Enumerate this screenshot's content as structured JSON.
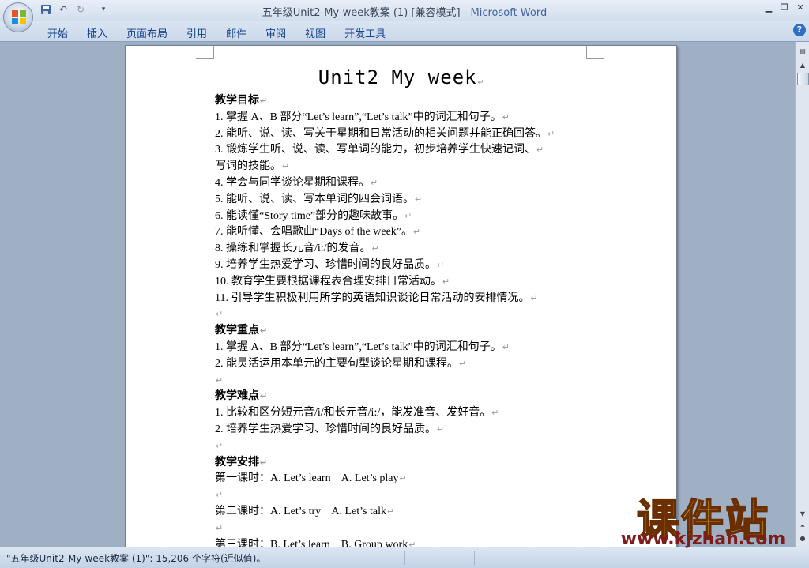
{
  "window": {
    "title": "五年级Unit2-My-week教案 (1) [兼容模式] - ",
    "app_name": "Microsoft Word"
  },
  "quick_access": {
    "save_icon": "save-icon",
    "undo_icon": "undo-icon",
    "redo_icon": "redo-icon",
    "customize_icon": "customize-icon"
  },
  "ribbon": {
    "tabs": [
      "开始",
      "插入",
      "页面布局",
      "引用",
      "邮件",
      "审阅",
      "视图",
      "开发工具"
    ],
    "help": "?"
  },
  "document": {
    "title": "Unit2 My week",
    "sections": [
      {
        "heading": "教学目标",
        "items": [
          "1. 掌握 A、B 部分“Let’s learn”,“Let’s talk”中的词汇和句子。",
          "2. 能听、说、读、写关于星期和日常活动的相关问题并能正确回答。",
          "3. 锻炼学生听、说、读、写单词的能力，初步培养学生快速记词、",
          "写词的技能。",
          "4. 学会与同学谈论星期和课程。",
          "5. 能听、说、读、写本单词的四会词语。",
          "6. 能读懂“Story time”部分的趣味故事。",
          "7. 能听懂、会唱歌曲“Days of the week”。",
          "8. 操练和掌握长元音/i:/的发音。",
          "9. 培养学生热爱学习、珍惜时间的良好品质。",
          "10. 教育学生要根据课程表合理安排日常活动。",
          "11. 引导学生积极利用所学的英语知识谈论日常活动的安排情况。"
        ]
      },
      {
        "heading": "教学重点",
        "items": [
          "1. 掌握 A、B 部分“Let’s learn”,“Let’s talk”中的词汇和句子。",
          "2. 能灵活运用本单元的主要句型谈论星期和课程。"
        ]
      },
      {
        "heading": "教学难点",
        "items": [
          "1. 比较和区分短元音/i/和长元音/i:/，能发准音、发好音。",
          "2. 培养学生热爱学习、珍惜时间的良好品质。"
        ]
      },
      {
        "heading": "教学安排",
        "items": [
          "第一课时：A. Let’s learn    A. Let’s play",
          "",
          "第二课时：A. Let’s try    A. Let’s talk",
          "",
          "第三课时：B. Let’s learn    B. Group work"
        ]
      }
    ]
  },
  "status_bar": {
    "text": "\"五年级Unit2-My-week教案 (1)\": 15,206 个字符(近似值)。"
  },
  "watermark": {
    "text": "课件站",
    "url": "www.kjzhan.com"
  },
  "colors": {
    "ribbon_text": "#15428b",
    "app_name": "#4163a5",
    "watermark_fill": "#f7e51c",
    "watermark_url": "#7e1b1b"
  }
}
